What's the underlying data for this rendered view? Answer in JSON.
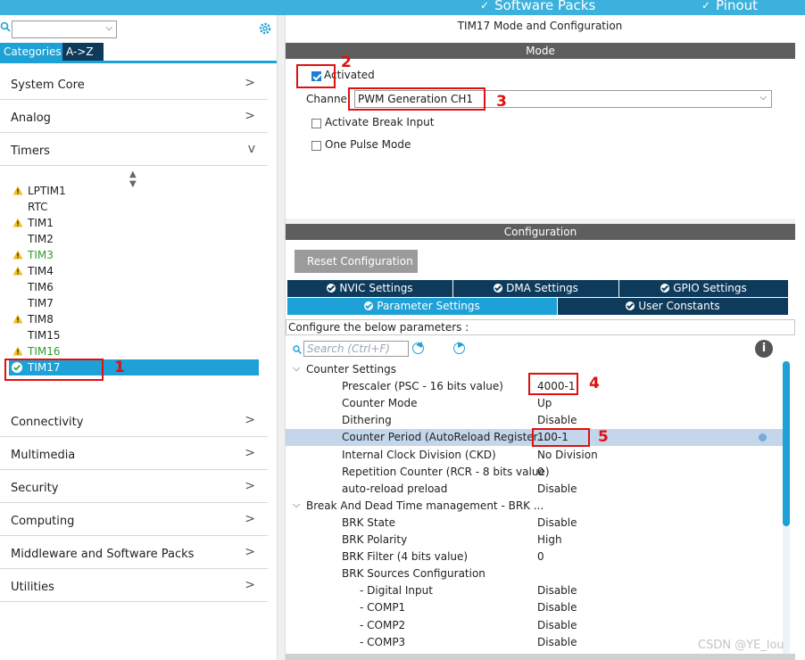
{
  "topbar": {
    "menus": [
      {
        "label": "Software Packs"
      },
      {
        "label": "Pinout"
      }
    ]
  },
  "left": {
    "tabs": [
      {
        "label": "Categories",
        "active": true
      },
      {
        "label": "A->Z",
        "active": false
      }
    ],
    "categories_top": [
      {
        "label": "System Core",
        "arrow": ">"
      },
      {
        "label": "Analog",
        "arrow": ">"
      },
      {
        "label": "Timers",
        "arrow": "v"
      }
    ],
    "peripherals": [
      {
        "label": "LPTIM1",
        "status": "warning"
      },
      {
        "label": "RTC",
        "status": "none"
      },
      {
        "label": "TIM1",
        "status": "warning"
      },
      {
        "label": "TIM2",
        "status": "none"
      },
      {
        "label": "TIM3",
        "status": "warning-green"
      },
      {
        "label": "TIM4",
        "status": "warning"
      },
      {
        "label": "TIM6",
        "status": "none"
      },
      {
        "label": "TIM7",
        "status": "none"
      },
      {
        "label": "TIM8",
        "status": "warning"
      },
      {
        "label": "TIM15",
        "status": "none"
      },
      {
        "label": "TIM16",
        "status": "warning-green"
      },
      {
        "label": "TIM17",
        "status": "selected"
      }
    ],
    "categories_bottom": [
      {
        "label": "Connectivity",
        "arrow": ">"
      },
      {
        "label": "Multimedia",
        "arrow": ">"
      },
      {
        "label": "Security",
        "arrow": ">"
      },
      {
        "label": "Computing",
        "arrow": ">"
      },
      {
        "label": "Middleware and Software Packs",
        "arrow": ">"
      },
      {
        "label": "Utilities",
        "arrow": ">"
      }
    ]
  },
  "right": {
    "title": "TIM17 Mode and Configuration",
    "mode_bar": "Mode",
    "activated_label": "Activated",
    "channel_label": "Channel",
    "channel_value": "PWM Generation CH1",
    "break_input_label": "Activate Break Input",
    "one_pulse_label": "One Pulse Mode",
    "config_bar": "Configuration",
    "reset_label": "Reset Configuration",
    "tabs_row1": [
      "NVIC Settings",
      "DMA Settings",
      "GPIO Settings"
    ],
    "tabs_row2": [
      "Parameter Settings",
      "User Constants"
    ],
    "hint": "Configure the below parameters :",
    "search_placeholder": "Search (Ctrl+F)",
    "info_symbol": "i",
    "params": [
      {
        "name": "Counter Settings",
        "value": "",
        "type": "group"
      },
      {
        "name": "Prescaler (PSC - 16 bits value)",
        "value": "4000-1",
        "type": "param"
      },
      {
        "name": "Counter Mode",
        "value": "Up",
        "type": "param"
      },
      {
        "name": "Dithering",
        "value": "Disable",
        "type": "param"
      },
      {
        "name": "Counter Period (AutoReload Register...",
        "value": "100-1",
        "type": "param"
      },
      {
        "name": "Internal Clock Division (CKD)",
        "value": "No Division",
        "type": "param"
      },
      {
        "name": "Repetition Counter (RCR - 8 bits value)",
        "value": "0",
        "type": "param"
      },
      {
        "name": "auto-reload preload",
        "value": "Disable",
        "type": "param"
      },
      {
        "name": "Break And Dead Time management - BRK ...",
        "value": "",
        "type": "group"
      },
      {
        "name": "BRK State",
        "value": "Disable",
        "type": "param"
      },
      {
        "name": "BRK Polarity",
        "value": "High",
        "type": "param"
      },
      {
        "name": "BRK Filter (4 bits value)",
        "value": "0",
        "type": "param"
      },
      {
        "name": "BRK Sources Configuration",
        "value": "",
        "type": "param"
      },
      {
        "name": "- Digital Input",
        "value": "Disable",
        "type": "sub"
      },
      {
        "name": "- COMP1",
        "value": "Disable",
        "type": "sub"
      },
      {
        "name": "- COMP2",
        "value": "Disable",
        "type": "sub"
      },
      {
        "name": "- COMP3",
        "value": "Disable",
        "type": "sub"
      }
    ]
  },
  "annotations": [
    "1",
    "2",
    "3",
    "4",
    "5"
  ],
  "watermark": "CSDN @YE_lou",
  "colors": {
    "accent": "#1da1d6",
    "dark_tab": "#0e3a5c",
    "annotation": "#e01010"
  }
}
